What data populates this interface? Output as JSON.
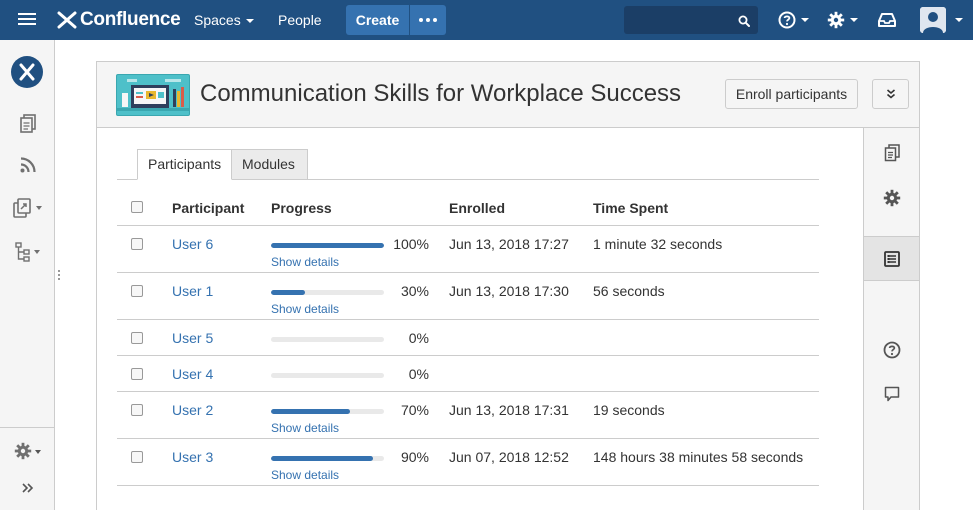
{
  "topnav": {
    "brand": "Confluence",
    "spaces_label": "Spaces",
    "people_label": "People",
    "create_label": "Create",
    "search_placeholder": "",
    "icons": [
      "menu-icon",
      "search-icon",
      "help-icon",
      "gear-icon",
      "notifications-icon",
      "avatar"
    ]
  },
  "sidebar": {
    "icons": [
      "space-logo",
      "pages-icon",
      "blog-icon",
      "shortcuts-icon",
      "page-tree-icon",
      "space-settings-icon",
      "expand-sidebar-icon"
    ]
  },
  "course": {
    "title": "Communication Skills for Workplace Success",
    "enroll_label": "Enroll participants",
    "colors": {
      "thumb": "#4ec0c9",
      "accent": "#3572b0",
      "nav": "#205081"
    }
  },
  "tabs": [
    {
      "label": "Participants",
      "active": true
    },
    {
      "label": "Modules",
      "active": false
    }
  ],
  "table": {
    "headers": {
      "participant": "Participant",
      "progress": "Progress",
      "enrolled": "Enrolled",
      "time_spent": "Time Spent"
    },
    "details_label": "Show details",
    "rows": [
      {
        "user": "User 6",
        "progress": 100,
        "progress_label": "100%",
        "enrolled": "Jun 13, 2018 17:27",
        "time_spent": "1 minute 32 seconds",
        "has_details": true
      },
      {
        "user": "User 1",
        "progress": 30,
        "progress_label": "30%",
        "enrolled": "Jun 13, 2018 17:30",
        "time_spent": "56 seconds",
        "has_details": true
      },
      {
        "user": "User 5",
        "progress": 0,
        "progress_label": "0%",
        "enrolled": "",
        "time_spent": "",
        "has_details": false
      },
      {
        "user": "User 4",
        "progress": 0,
        "progress_label": "0%",
        "enrolled": "",
        "time_spent": "",
        "has_details": false
      },
      {
        "user": "User 2",
        "progress": 70,
        "progress_label": "70%",
        "enrolled": "Jun 13, 2018 17:31",
        "time_spent": "19 seconds",
        "has_details": true
      },
      {
        "user": "User 3",
        "progress": 90,
        "progress_label": "90%",
        "enrolled": "Jun 07, 2018 12:52",
        "time_spent": "148 hours 38 minutes 58 seconds",
        "has_details": true
      }
    ]
  },
  "right_rail": {
    "icons": [
      "page-info-icon",
      "settings-icon",
      "participants-list-icon",
      "help-icon",
      "comment-icon"
    ]
  }
}
